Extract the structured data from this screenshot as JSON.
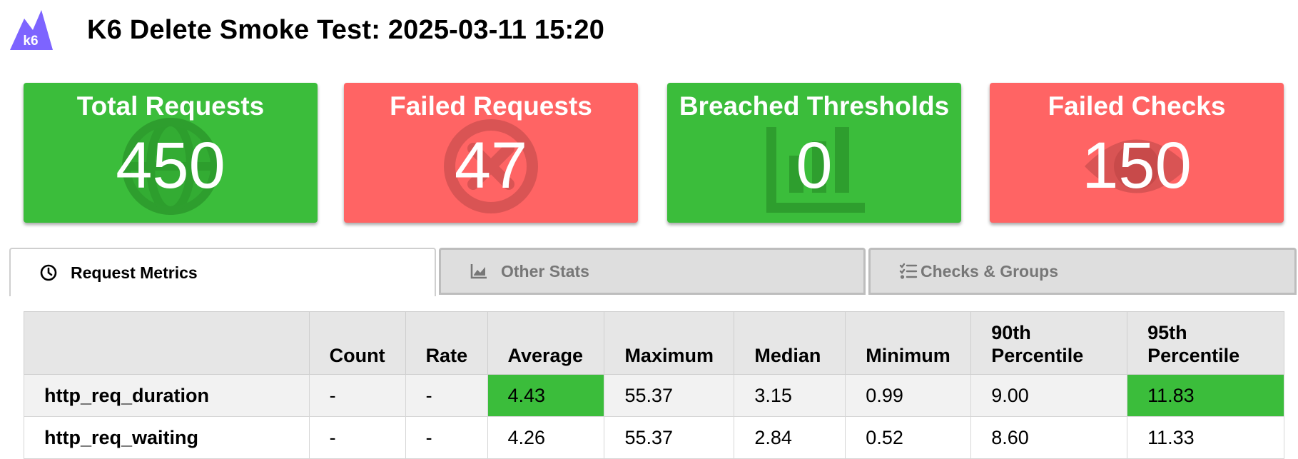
{
  "header": {
    "logo_text": "k6",
    "title": "K6 Delete Smoke Test: 2025-03-11 15:20"
  },
  "cards": [
    {
      "label": "Total Requests",
      "value": "450",
      "status": "green",
      "icon": "globe-icon"
    },
    {
      "label": "Failed Requests",
      "value": "47",
      "status": "red",
      "icon": "cancel-icon"
    },
    {
      "label": "Breached Thresholds",
      "value": "0",
      "status": "green",
      "icon": "bar-chart-icon"
    },
    {
      "label": "Failed Checks",
      "value": "150",
      "status": "red",
      "icon": "eye-icon"
    }
  ],
  "colors": {
    "green": "#3bbd3b",
    "red": "#ff6464",
    "header_bg": "#e6e6e6"
  },
  "tabs": [
    {
      "label": "Request Metrics",
      "icon": "clock-icon",
      "active": true
    },
    {
      "label": "Other Stats",
      "icon": "area-chart-icon",
      "active": false
    },
    {
      "label": "Checks & Groups",
      "icon": "tasks-icon",
      "active": false
    }
  ],
  "table": {
    "columns": [
      "",
      "Count",
      "Rate",
      "Average",
      "Maximum",
      "Median",
      "Minimum",
      "90th Percentile",
      "95th Percentile"
    ],
    "rows": [
      {
        "name": "http_req_duration",
        "cells": [
          "-",
          "-",
          "4.43",
          "55.37",
          "3.15",
          "0.99",
          "9.00",
          "11.83"
        ],
        "highlight": [
          2,
          7
        ]
      },
      {
        "name": "http_req_waiting",
        "cells": [
          "-",
          "-",
          "4.26",
          "55.37",
          "2.84",
          "0.52",
          "8.60",
          "11.33"
        ],
        "highlight": []
      }
    ]
  }
}
